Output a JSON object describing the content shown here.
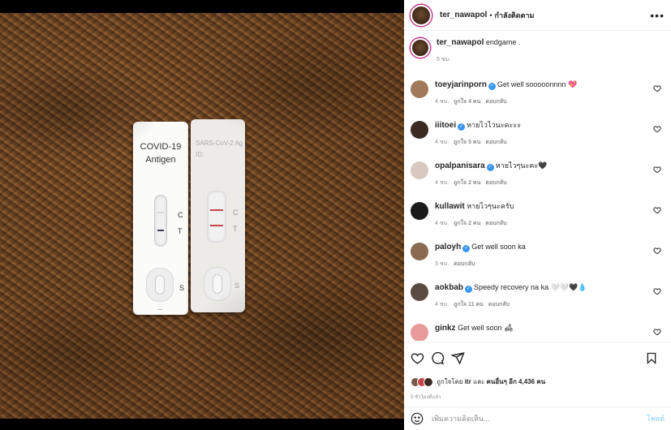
{
  "post": {
    "username": "ter_nawapol",
    "separator": "•",
    "follow_status": "กำลังติดตาม",
    "more_icon": "more-horizontal-icon",
    "caption": "endgame .",
    "caption_time": "5 ชม."
  },
  "image": {
    "kit1_title_line1": "COVID-19",
    "kit1_title_line2": "Antigen",
    "kit1_mark_c": "C",
    "kit1_mark_t": "T",
    "kit1_mark_s": "S",
    "kit2_title_line1": "SARS-CoV-2 Ag",
    "kit2_title_line2": "ID:",
    "kit2_mark_c": "C",
    "kit2_mark_t": "T",
    "kit2_mark_s": "S",
    "band_color_dark": "#3a3a5a",
    "band_color_red": "#c9444a"
  },
  "comments": [
    {
      "name": "toeyjarinporn",
      "verified": true,
      "text": "Get well sooooonnnn 💖",
      "time": "4 ชม.",
      "likes": "ถูกใจ 4 คน",
      "reply": "ตอบกลับ",
      "avatar_color": "#a07a5a"
    },
    {
      "name": "iiitoei",
      "verified": true,
      "text": "หายไวไวนะคะะะ",
      "time": "4 ชม.",
      "likes": "ถูกใจ 5 คน",
      "reply": "ตอบกลับ",
      "avatar_color": "#3a2a22"
    },
    {
      "name": "opalpanisara",
      "verified": true,
      "text": "หายไวๆนะคะ🖤",
      "time": "4 ชม.",
      "likes": "ถูกใจ 2 คน",
      "reply": "ตอบกลับ",
      "avatar_color": "#d8c8c0"
    },
    {
      "name": "kullawit",
      "verified": false,
      "text": "หายไวๆนะครับ",
      "time": "4 ชม.",
      "likes": "ถูกใจ 2 คน",
      "reply": "ตอบกลับ",
      "avatar_color": "#1a1a1a"
    },
    {
      "name": "paloyh",
      "verified": true,
      "text": "Get well soon ka",
      "time": "3 ชม.",
      "likes": "",
      "reply": "ตอบกลับ",
      "avatar_color": "#8a6a50"
    },
    {
      "name": "aokbab",
      "verified": true,
      "text": "Speedy recovery na ka 🤍🤍🖤💧",
      "time": "4 ชม.",
      "likes": "ถูกใจ 11 คน",
      "reply": "ตอบกลับ",
      "avatar_color": "#5a4a40"
    },
    {
      "name": "ginkz",
      "verified": false,
      "text": "Get well soon 🛋",
      "time": "",
      "likes": "",
      "reply": "",
      "avatar_color": "#e89a9a"
    }
  ],
  "actions": {
    "like_icon": "heart-icon",
    "comment_icon": "comment-icon",
    "share_icon": "send-icon",
    "save_icon": "bookmark-icon",
    "liked_by_prefix": "ถูกใจโดย",
    "liked_by_user": "itr",
    "liked_by_and": "และ",
    "liked_by_others": "คนอื่นๆ อีก 4,436 คน",
    "time_ago": "5 ชั่วโมงที่แล้ว"
  },
  "comment_box": {
    "emoji_icon": "smiley-icon",
    "placeholder": "เพิ่มความคิดเห็น...",
    "post_label": "โพสต์"
  },
  "colors": {
    "link": "#3897f0",
    "post_disabled": "#b2dffc"
  }
}
